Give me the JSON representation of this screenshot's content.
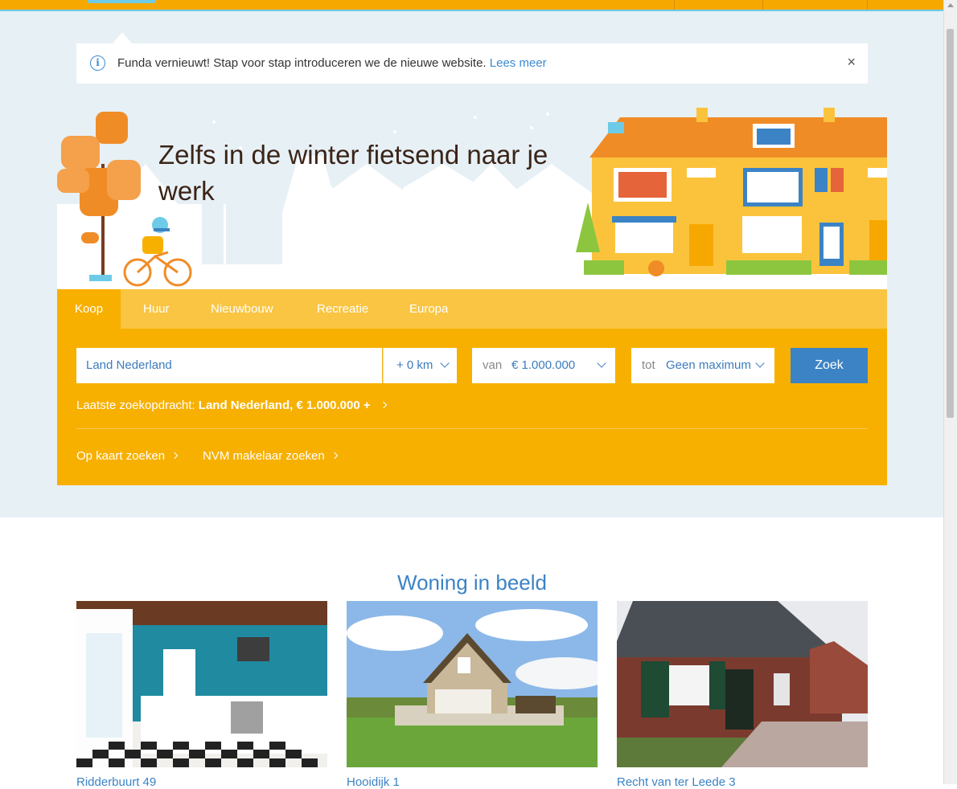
{
  "notice": {
    "message": "Funda vernieuwt! Stap voor stap introduceren we de nieuwe website.",
    "link": "Lees meer",
    "close": "×"
  },
  "hero": {
    "title": "Zelfs in de winter fietsend naar je werk"
  },
  "search": {
    "tabs": [
      "Koop",
      "Huur",
      "Nieuwbouw",
      "Recreatie",
      "Europa"
    ],
    "active_tab": "Koop",
    "location_value": "Land Nederland",
    "radius_value": "+ 0 km",
    "price_from_label": "van",
    "price_from_value": "€ 1.000.000",
    "price_to_label": "tot",
    "price_to_value": "Geen maximum",
    "submit_label": "Zoek",
    "recent_prefix": "Laatste zoekopdracht:",
    "recent_value": "Land Nederland, € 1.000.000 +",
    "links": [
      "Op kaart zoeken",
      "NVM makelaar zoeken"
    ]
  },
  "section": {
    "title": "Woning in beeld",
    "cards": [
      {
        "label": "Ridderbuurt 49"
      },
      {
        "label": "Hooidijk 1"
      },
      {
        "label": "Recht van ter Leede 3"
      }
    ]
  },
  "colors": {
    "brand_orange": "#f7b000",
    "tab_bar": "#f9c542",
    "link_blue": "#3c83c5",
    "background": "#e7f0f5"
  }
}
